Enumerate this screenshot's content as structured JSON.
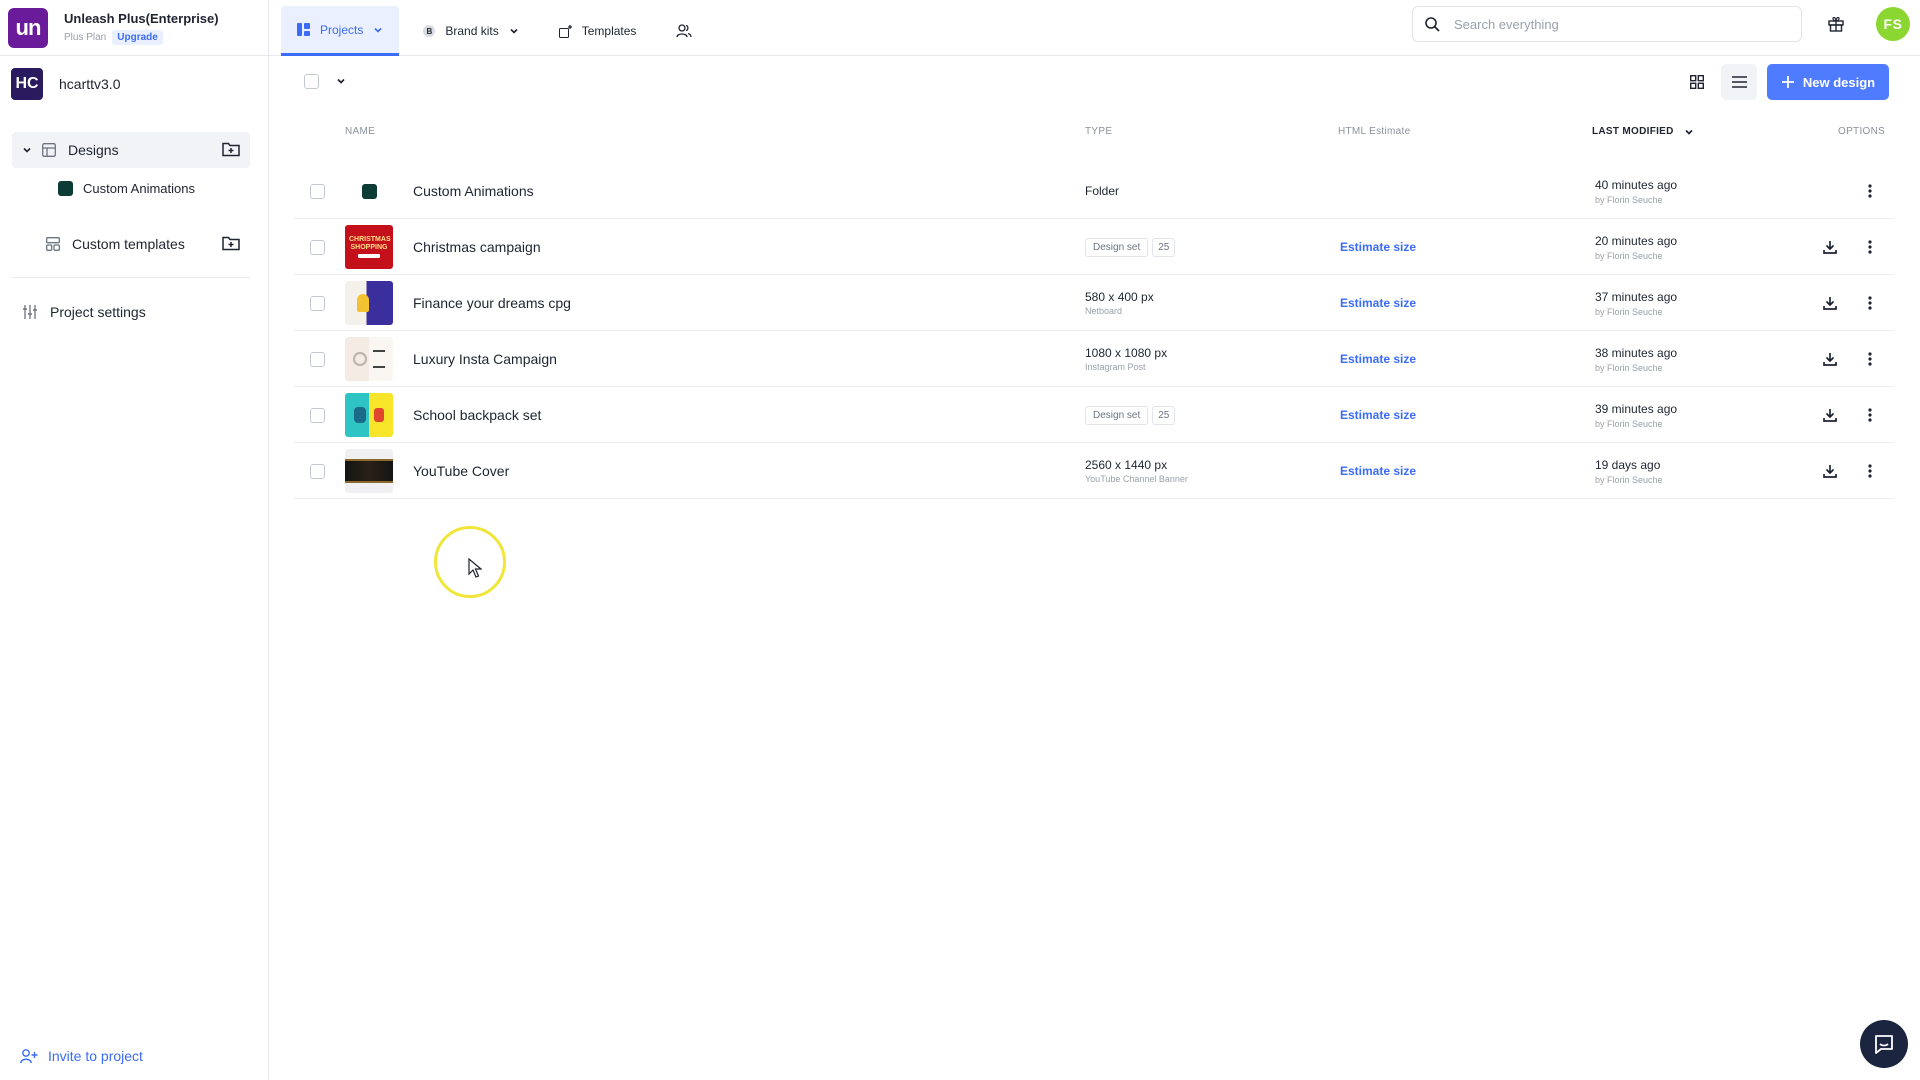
{
  "org": {
    "logo": "un",
    "name": "Unleash Plus(Enterprise)",
    "plan": "Plus Plan",
    "upgrade": "Upgrade",
    "brand_color": "#6a1b9a"
  },
  "nav": {
    "tabs": [
      {
        "label": "Projects",
        "icon": "projects-icon",
        "active": true
      },
      {
        "label": "Brand kits",
        "icon": "brand-kit-icon",
        "badge": "B"
      },
      {
        "label": "Templates",
        "icon": "templates-icon"
      }
    ],
    "people_icon": "users-icon"
  },
  "search": {
    "placeholder": "Search everything"
  },
  "user": {
    "initials": "FS",
    "avatar_color": "#8bd630"
  },
  "sidebar": {
    "project_logo": "HC",
    "project_name": "hcarttv3.0",
    "designs": "Designs",
    "designs_child": "Custom Animations",
    "custom_templates": "Custom templates",
    "project_settings": "Project settings",
    "invite": "Invite to project"
  },
  "toolbar": {
    "new_design": "New design",
    "accent": "#4f7cff"
  },
  "table": {
    "headers": {
      "name": "NAME",
      "type": "TYPE",
      "estimate": "HTML Estimate",
      "modified": "LAST MODIFIED",
      "options": "OPTIONS"
    },
    "rows": [
      {
        "name": "Custom Animations",
        "type_main": "Folder",
        "type_sub": "",
        "tag": "",
        "tag_count": "",
        "estimate": "",
        "modified": "40 minutes ago",
        "by": "by Florin Seuche",
        "thumb": "folder",
        "download": false
      },
      {
        "name": "Christmas campaign",
        "type_main": "",
        "type_sub": "",
        "tag": "Design set",
        "tag_count": "25",
        "estimate": "Estimate size",
        "modified": "20 minutes ago",
        "by": "by Florin Seuche",
        "thumb": "christmas",
        "thumb_text": "CHRISTMAS SHOPPING",
        "download": true
      },
      {
        "name": "Finance your dreams cpg",
        "type_main": "580 x 400 px",
        "type_sub": "Netboard",
        "tag": "",
        "tag_count": "",
        "estimate": "Estimate size",
        "modified": "37 minutes ago",
        "by": "by Florin Seuche",
        "thumb": "finance",
        "download": true
      },
      {
        "name": "Luxury Insta Campaign",
        "type_main": "1080 x 1080 px",
        "type_sub": "Instagram Post",
        "tag": "",
        "tag_count": "",
        "estimate": "Estimate size",
        "modified": "38 minutes ago",
        "by": "by Florin Seuche",
        "thumb": "luxury",
        "download": true
      },
      {
        "name": "School backpack set",
        "type_main": "",
        "type_sub": "",
        "tag": "Design set",
        "tag_count": "25",
        "estimate": "Estimate size",
        "modified": "39 minutes ago",
        "by": "by Florin Seuche",
        "thumb": "school",
        "download": true
      },
      {
        "name": "YouTube Cover",
        "type_main": "2560 x 1440 px",
        "type_sub": "YouTube Channel Banner",
        "tag": "",
        "tag_count": "",
        "estimate": "Estimate size",
        "modified": "19 days ago",
        "by": "by Florin Seuche",
        "thumb": "youtube",
        "download": true
      }
    ]
  }
}
